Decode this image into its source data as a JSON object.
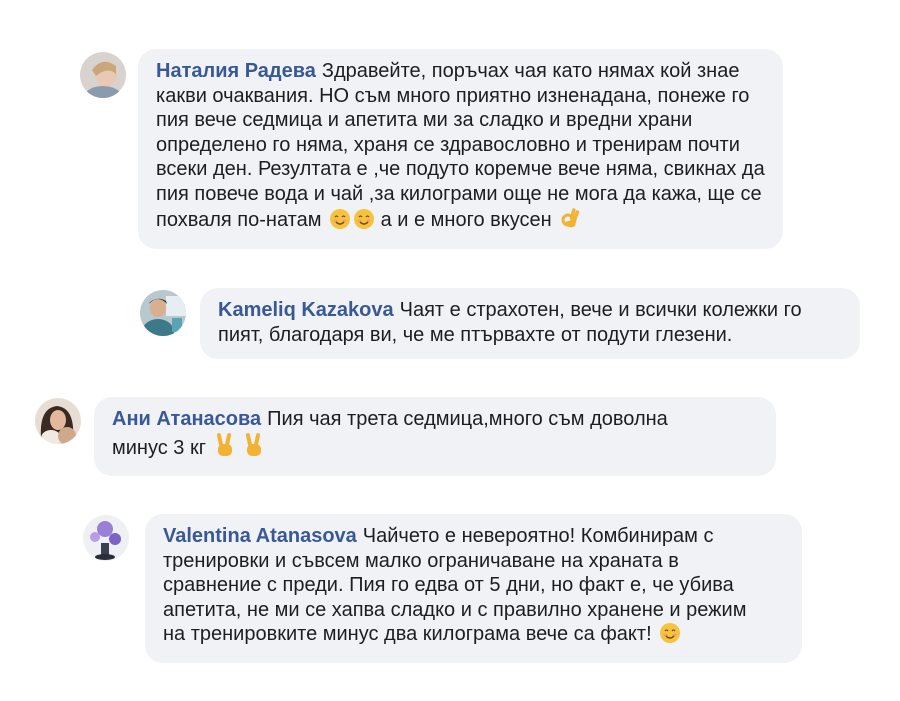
{
  "comments": [
    {
      "author": "Наталия Радева",
      "text": "Здравейте, поръчах чая като нямах кой знае\nкакви очаквания. НО съм много приятно изненадана, понеже го\nпия вече седмица и апетита ми за сладко и вредни храни\nопределено го няма, храня се здравословно и тренирам почти\nвсеки ден. Резултата е ,че подуто коремче вече няма, свикнах да\nпия повече вода и чай ,за килограми още не мога да кажа, ще се\nпохваля по-натам",
      "after_emoji_text": " а и е много вкусен",
      "emojis": [
        "smiling-face-icon",
        "smiling-face-icon",
        "ok-hand-icon"
      ]
    },
    {
      "author": "Kameliq Kazakova",
      "text": "Чаят е страхотен, вече и всички колежки го\nпият, благодаря ви, че ме птървахте от подути глезени.",
      "emojis": []
    },
    {
      "author": "Ани Атанасова",
      "text": "Пия чая трета седмица,много съм доволна\nминус 3 кг",
      "emojis": [
        "victory-hand-icon",
        "victory-hand-icon"
      ]
    },
    {
      "author": "Valentina Atanasova",
      "text": "Чайчето е невероятно! Комбинирам с\nтренировки и съвсем малко ограничаване на храната в\nсравнение с преди. Пия го едва от 5 дни, но факт е, че убива\nапетита, не ми се хапва сладко и с правилно хранене и режим\nна тренировките минус два килограма вече са факт!",
      "emojis": [
        "smiling-face-icon"
      ]
    }
  ],
  "colors": {
    "author": "#385898",
    "bubble": "#f0f2f5",
    "text": "#1c1e21"
  }
}
